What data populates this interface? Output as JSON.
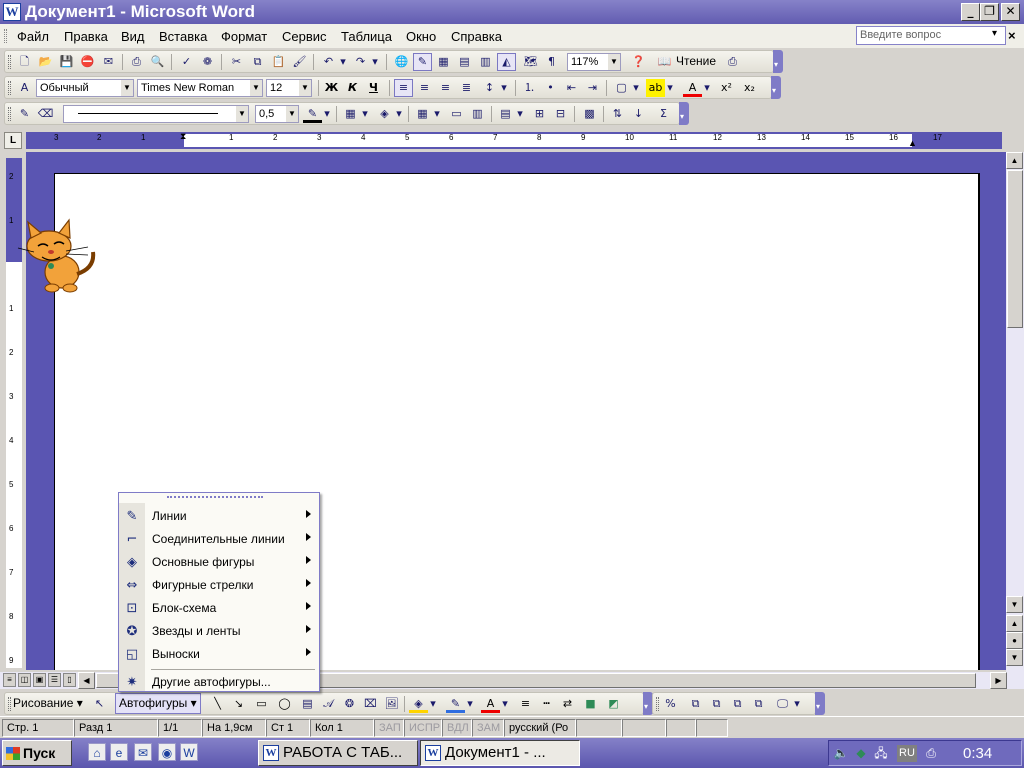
{
  "window": {
    "title": "Документ1 - Microsoft Word",
    "app_icon": "W"
  },
  "menubar": {
    "items": [
      "Файл",
      "Правка",
      "Вид",
      "Вставка",
      "Формат",
      "Сервис",
      "Таблица",
      "Окно",
      "Справка"
    ],
    "ask_placeholder": "Введите вопрос"
  },
  "standard_toolbar": {
    "zoom": "117%",
    "reading_label": "Чтение"
  },
  "formatting_toolbar": {
    "style": "Обычный",
    "font": "Times New Roman",
    "size": "12"
  },
  "tables_toolbar": {
    "line_weight": "0,5"
  },
  "ruler": {
    "corner": "L",
    "h_ticks": [
      "3",
      "2",
      "1",
      "1",
      "2",
      "3",
      "4",
      "5",
      "6",
      "7",
      "8",
      "9",
      "10",
      "11",
      "12",
      "13",
      "14",
      "15",
      "16",
      "17"
    ],
    "v_ticks": [
      "2",
      "1",
      "1",
      "2",
      "3",
      "4",
      "5",
      "6",
      "7",
      "8",
      "9"
    ]
  },
  "autoshapes_menu": {
    "items": [
      {
        "label": "Линии",
        "icon": "lines-icon",
        "glyph": "✎",
        "has_submenu": true
      },
      {
        "label": "Соединительные линии",
        "icon": "connectors-icon",
        "glyph": "⌐",
        "has_submenu": true
      },
      {
        "label": "Основные фигуры",
        "icon": "basic-shapes-icon",
        "glyph": "◈",
        "has_submenu": true
      },
      {
        "label": "Фигурные стрелки",
        "icon": "block-arrows-icon",
        "glyph": "⇔",
        "has_submenu": true
      },
      {
        "label": "Блок-схема",
        "icon": "flowchart-icon",
        "glyph": "⊡",
        "has_submenu": true
      },
      {
        "label": "Звезды и ленты",
        "icon": "stars-banners-icon",
        "glyph": "✪",
        "has_submenu": true
      },
      {
        "label": "Выноски",
        "icon": "callouts-icon",
        "glyph": "◱",
        "has_submenu": true
      },
      {
        "label": "Другие автофигуры...",
        "icon": "more-autoshapes-icon",
        "glyph": "✷",
        "has_submenu": false
      }
    ]
  },
  "drawing_toolbar": {
    "draw_label": "Рисование",
    "autoshapes_label": "Автофигуры"
  },
  "statusbar": {
    "page": "Стр. 1",
    "section": "Разд 1",
    "pages": "1/1",
    "at": "На 1,9см",
    "line": "Ст 1",
    "col": "Кол 1",
    "rec": "ЗАП",
    "trk": "ИСПР",
    "ext": "ВДЛ",
    "ovr": "ЗАМ",
    "language": "русский (Ро"
  },
  "taskbar": {
    "start": "Пуск",
    "tasks": [
      "РАБОТА С ТАБ...",
      "Документ1 - ..."
    ],
    "language": "RU",
    "clock": "0:34"
  },
  "colors": {
    "accent": "#5a55b2",
    "titlebar": "#625cb1"
  }
}
